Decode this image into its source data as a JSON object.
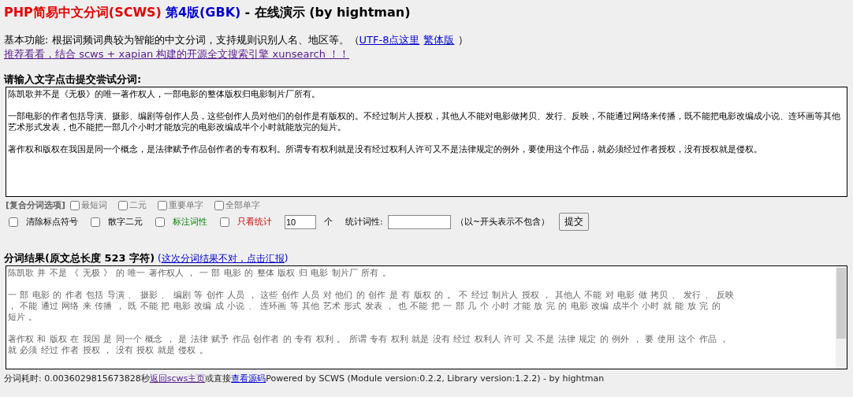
{
  "title": {
    "product": "PHP简易中文分词(SCWS)",
    "version": "第4版(GBK)",
    "rest": "- 在线演示 (by hightman)"
  },
  "intro": {
    "text": "基本功能: 根据词频词典较为智能的中文分词，支持规则识别人名、地区等。（",
    "links": [
      "UTF-8点这里",
      "繁体版"
    ],
    "close": "）"
  },
  "promo_link": "推荐看看，结合 scws + xapian 构建的开源全文搜索引擎 xunsearch ！！",
  "input_heading": "请输入文字点击提交尝试分词:",
  "input_text": [
    "陈凯歌并不是《无极》的唯一著作权人，一部电影的整体版权归电影制片厂所有。",
    "一部电影的作者包括导演、摄影、编剧等创作人员，这些创作人员对他们的创作是有版权的。不经过制片人授权，其他人不能对电影做拷贝、发行、反映，不能通过网络来传播，既不能把电影改编成小说、连环画等其他艺术形式发表，也不能把一部几个小时才能放完的电影改编成半个小时就能放完的短片。",
    "著作权和版权在我国是同一个概念，是法律赋予作品创作者的专有权利。所谓专有权利就是没有经过权利人许可又不是法律规定的例外，要使用这个作品，就必须经过作者授权，没有授权就是侵权。"
  ],
  "compound_label": "[复合分词选项]",
  "compound_options": [
    {
      "label": "最短词",
      "checked": false
    },
    {
      "label": "二元",
      "checked": false
    },
    {
      "label": "重要单字",
      "checked": false
    },
    {
      "label": "全部单字",
      "checked": false
    }
  ],
  "options": [
    {
      "label": "清除标点符号",
      "checked": false,
      "kind": "plain"
    },
    {
      "label": "散字二元",
      "checked": false,
      "kind": "plain"
    },
    {
      "label": "标注词性",
      "checked": false,
      "kind": "green"
    },
    {
      "label": "只看统计",
      "checked": false,
      "kind": "red"
    }
  ],
  "limit": {
    "value": "10",
    "unit": "个"
  },
  "stat_label": "统计词性:",
  "stat_hint": "（以~开头表示不包含）",
  "submit": "提交",
  "result_heading": "分词结果(原文总长度 523 字符)",
  "report_paren_open": "(",
  "report_link": "这次分词结果不对，点击汇报",
  "report_paren_close": ")",
  "result_text": [
    [
      "陈凯歌 并 不是 《 无极 》 的 唯一 著作权人 ， 一 部 电影 的 整体 版权 归 电影 制片厂 所有 。"
    ],
    [
      "一 部 电影 的 作者 包括 导演 、 摄影 、 编剧 等 创作 人员 ， 这些 创作 人员 对 他们 的 创作 是 有 版权 的 。 不 经过 制片人 授权 ， 其他人 不能 对 电影 做 拷贝 、 发行 、 反映",
      "， 不能 通过 网络 来 传播 ， 既 不能 把 电影 改编 成 小说 、 连环画 等 其他 艺术 形式 发表 ， 也 不能 把 一 部 几 个 小时 才能 放 完 的 电影 改编 成半个 小时 就 能 放 完 的",
      "短片 。"
    ],
    [
      "著作权 和 版权 在 我国 是 同一个 概念 ， 是 法律 赋予 作品 创作者 的 专有 权利 。 所谓 专有 权利 就是 没有 经过 权利人 许可 又 不是 法律 规定 的 例外 ， 要 使用 这个 作品 ，",
      "就 必须 经过 作者 授权 ， 没有 授权 就是 侵权 。"
    ]
  ],
  "footer": {
    "time": "分词耗时: 0.0036029815673828秒",
    "home_link": "返回scws主页",
    "middle": "或直接",
    "source_link": "查看源码",
    "powered": "Powered by SCWS (Module version:0.2.2, Library version:1.2.2) - by hightman"
  }
}
